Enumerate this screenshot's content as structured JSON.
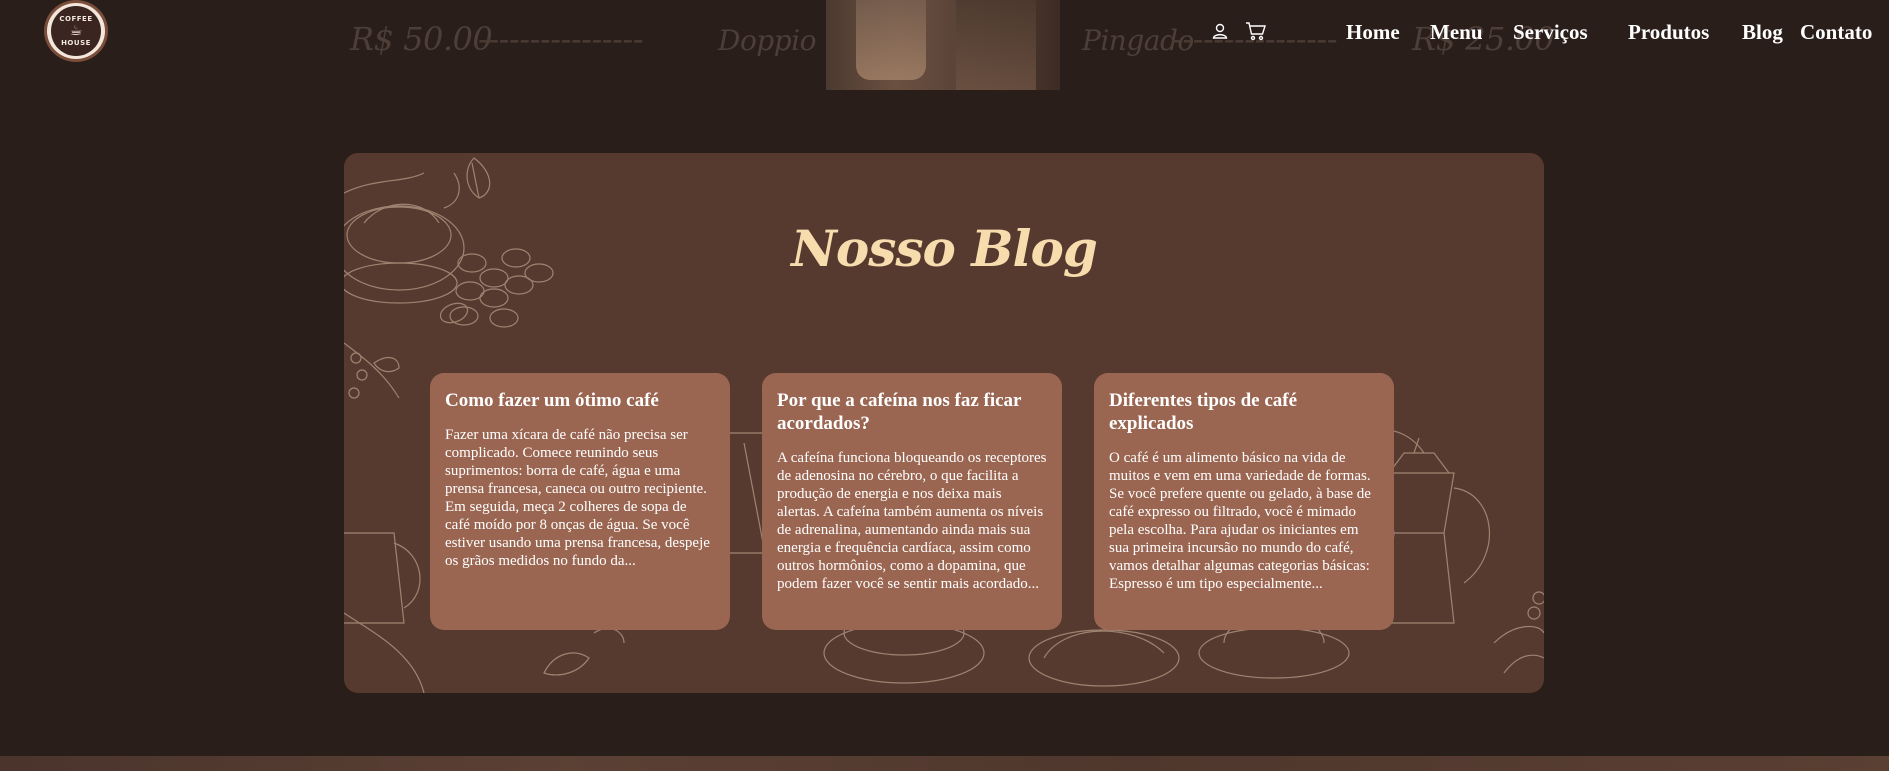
{
  "menu_strip": {
    "price_left": "R$ 50.00",
    "dashes_left": "----------------",
    "item_left": "Doppio",
    "item_right": "Pingado",
    "dashes_right": "----------------",
    "price_right": "R$ 25.00"
  },
  "header": {
    "logo": {
      "line1": "COFFEE",
      "line2": "HOUSE",
      "icon": "coffee-cup-icon"
    },
    "icons": {
      "user": "user-icon",
      "cart": "cart-icon"
    },
    "nav": [
      "Home",
      "Menu",
      "Serviços",
      "Produtos",
      "Blog",
      "Contato"
    ]
  },
  "blog": {
    "title": "Nosso Blog",
    "cards": [
      {
        "title": "Como fazer um ótimo café",
        "body": "Fazer uma xícara de café não precisa ser complicado. Comece reunindo seus suprimentos: borra de café, água e uma prensa francesa, caneca ou outro recipiente. Em seguida, meça 2 colheres de sopa de café moído por 8 onças de água. Se você estiver usando uma prensa francesa, despeje os grãos medidos no fundo da..."
      },
      {
        "title": "Por que a cafeína nos faz ficar acordados?",
        "body": "A cafeína funciona bloqueando os receptores de adenosina no cérebro, o que facilita a produção de energia e nos deixa mais alertas. A cafeína também aumenta os níveis de adrenalina, aumentando ainda mais sua energia e frequência cardíaca, assim como outros hormônios, como a dopamina, que podem fazer você se sentir mais acordado..."
      },
      {
        "title": "Diferentes tipos de café explicados",
        "body": "O café é um alimento básico na vida de muitos e vem em uma variedade de formas. Se você prefere quente ou gelado, à base de café expresso ou filtrado, você é mimado pela escolha. Para ajudar os iniciantes em sua primeira incursão no mundo do café, vamos detalhar algumas categorias básicas: Espresso é um tipo especialmente..."
      }
    ]
  },
  "colors": {
    "page_bg": "#2a1e1b",
    "section_bg": "#573a2f",
    "card_bg": "#9a6652",
    "title": "#f7dcae"
  }
}
